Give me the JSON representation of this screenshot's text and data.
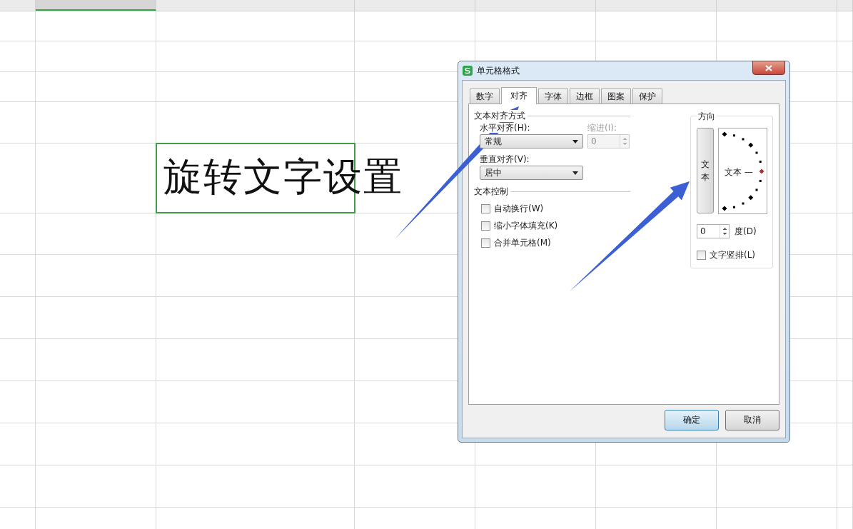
{
  "sheet": {
    "columns": [
      {
        "selected": false
      },
      {
        "selected": true
      },
      {
        "selected": false
      },
      {
        "selected": false
      },
      {
        "selected": false
      },
      {
        "selected": false
      },
      {
        "selected": false
      }
    ],
    "cell_text": "旋转文字设置"
  },
  "dialog": {
    "title": "单元格格式",
    "tabs": [
      {
        "label": "数字",
        "selected": false
      },
      {
        "label": "对齐",
        "selected": true
      },
      {
        "label": "字体",
        "selected": false
      },
      {
        "label": "边框",
        "selected": false
      },
      {
        "label": "图案",
        "selected": false
      },
      {
        "label": "保护",
        "selected": false
      }
    ],
    "alignment": {
      "legend": "文本对齐方式",
      "horizontal": {
        "label": "水平对齐(H):",
        "value": "常规"
      },
      "indent": {
        "label": "缩进(I):",
        "value": "0",
        "disabled": true
      },
      "vertical": {
        "label": "垂直对齐(V):",
        "value": "居中"
      }
    },
    "text_control": {
      "legend": "文本控制",
      "options": [
        {
          "label": "自动换行(W)",
          "checked": false
        },
        {
          "label": "缩小字体填充(K)",
          "checked": false
        },
        {
          "label": "合并单元格(M)",
          "checked": false
        }
      ]
    },
    "orientation": {
      "legend": "方向",
      "vertical_text": "文本",
      "dial_label": "文本 —",
      "degrees": {
        "value": "0",
        "label": "度(D)"
      },
      "stacked": {
        "label": "文字竖排(L)",
        "checked": false
      }
    },
    "buttons": [
      {
        "label": "确定",
        "default": true
      },
      {
        "label": "取消",
        "default": false
      }
    ]
  }
}
